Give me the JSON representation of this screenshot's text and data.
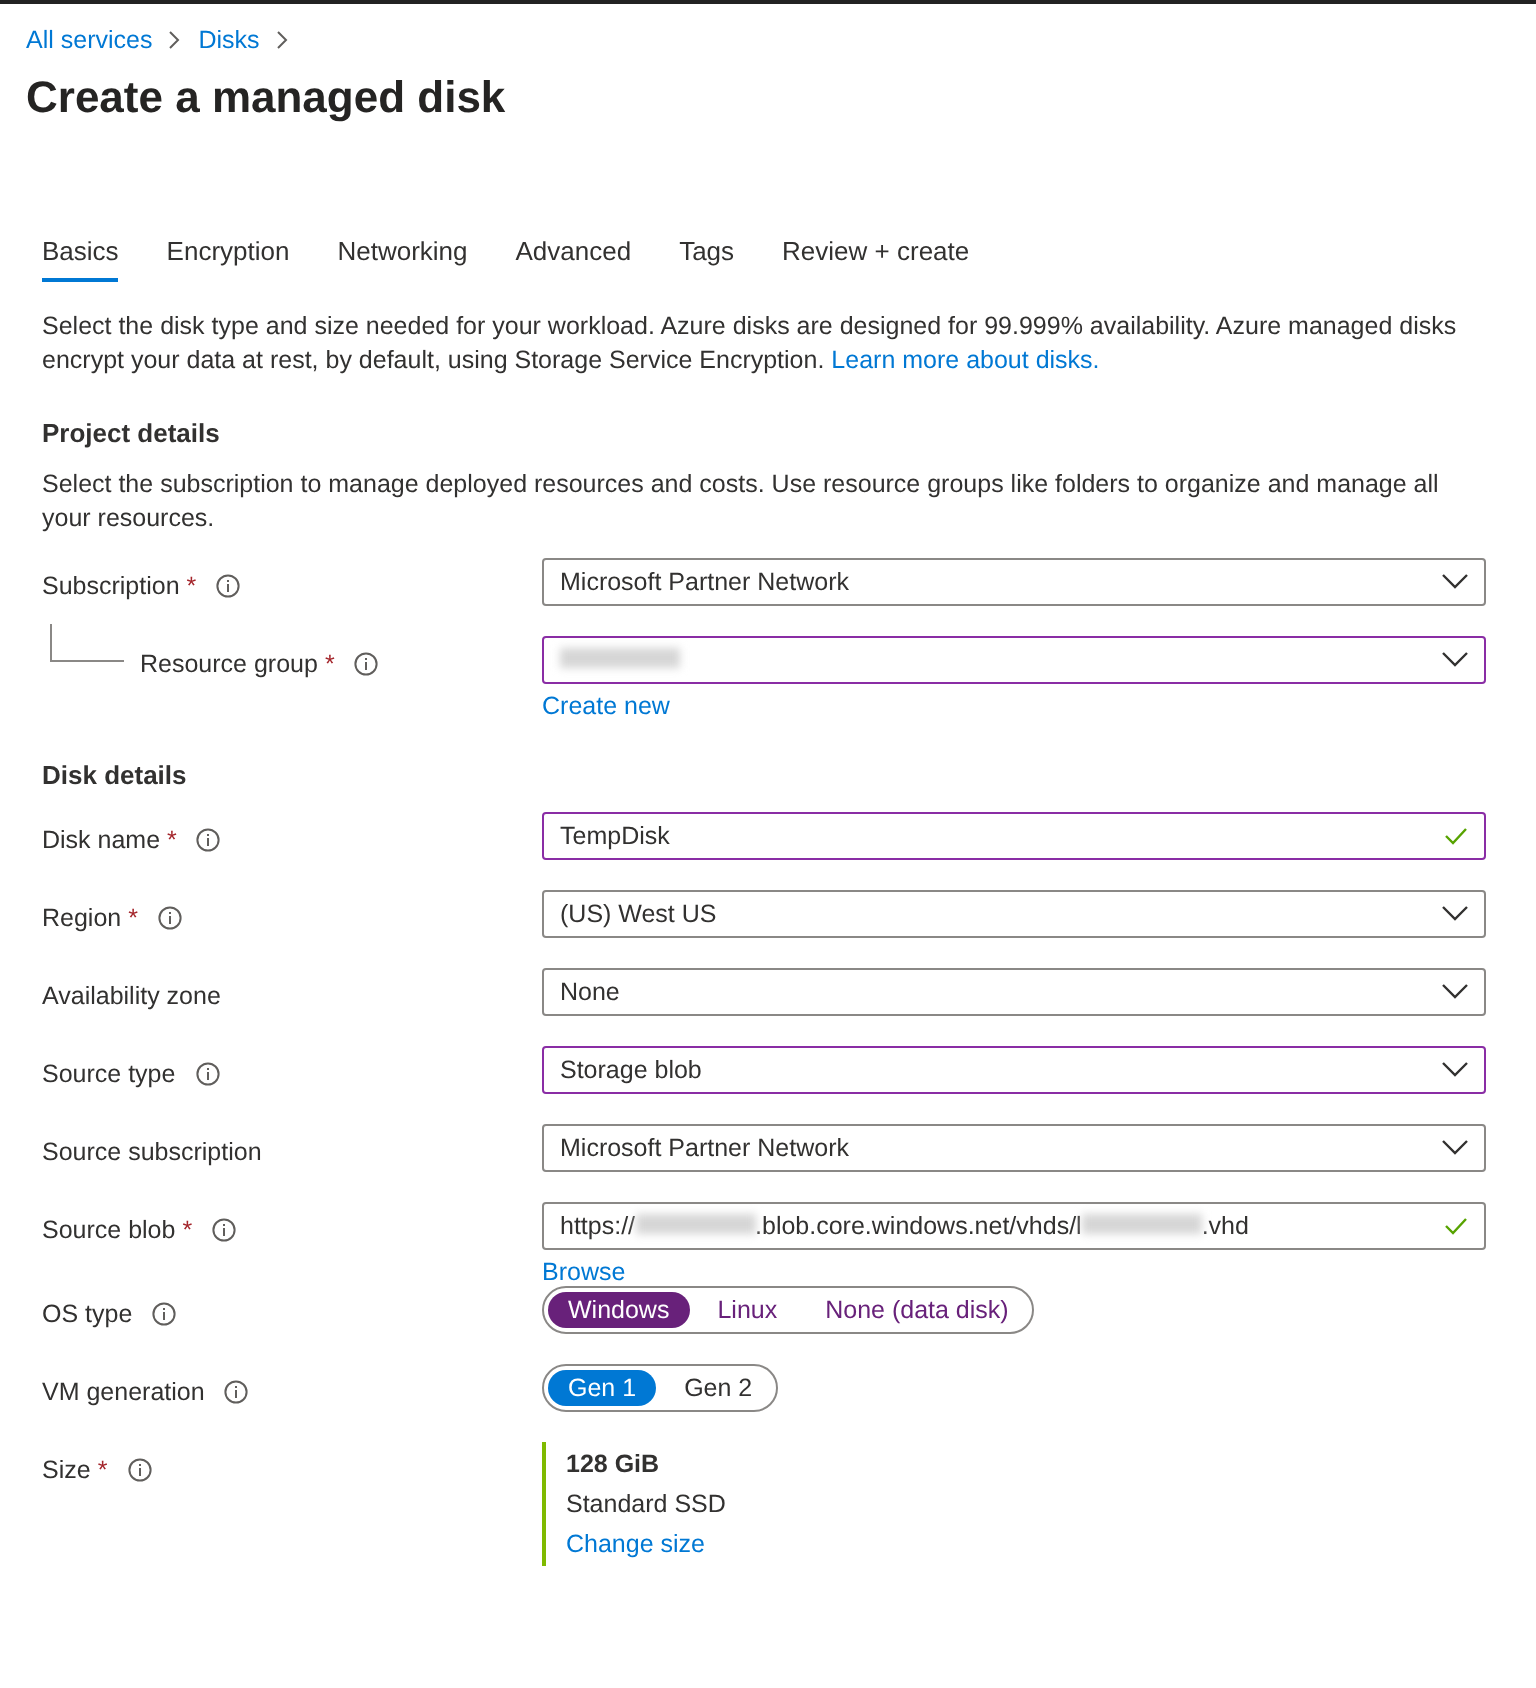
{
  "breadcrumb": [
    "All services",
    "Disks"
  ],
  "title": "Create a managed disk",
  "tabs": [
    {
      "label": "Basics",
      "selected": true
    },
    {
      "label": "Encryption",
      "selected": false
    },
    {
      "label": "Networking",
      "selected": false
    },
    {
      "label": "Advanced",
      "selected": false
    },
    {
      "label": "Tags",
      "selected": false
    },
    {
      "label": "Review + create",
      "selected": false
    }
  ],
  "intro": {
    "text": "Select the disk type and size needed for your workload. Azure disks are designed for 99.999% availability. Azure managed disks encrypt your data at rest, by default, using Storage Service Encryption.",
    "link": "Learn more about disks."
  },
  "sections": [
    {
      "heading": "Project details",
      "description": "Select the subscription to manage deployed resources and costs. Use resource groups like folders to organize and manage all your resources.",
      "rows": [
        {
          "kind": "select",
          "label": "Subscription",
          "required_mark": "*",
          "info": true,
          "highlighted": false,
          "valid": false,
          "value_parts": [
            {
              "kind": "text",
              "text": "Microsoft Partner Network"
            }
          ],
          "children": [
            {
              "kind": "select",
              "label": "Resource group",
              "required_mark": "*",
              "info": true,
              "highlighted": true,
              "valid": false,
              "value_parts": [
                {
                  "kind": "redacted"
                }
              ],
              "link": "Create new"
            }
          ]
        }
      ]
    },
    {
      "heading": "Disk details",
      "rows": [
        {
          "kind": "text",
          "label": "Disk name",
          "required_mark": "*",
          "info": true,
          "highlighted": true,
          "valid": true,
          "value_parts": [
            {
              "kind": "text",
              "text": "TempDisk"
            }
          ]
        },
        {
          "kind": "select",
          "label": "Region",
          "required_mark": "*",
          "info": true,
          "highlighted": false,
          "valid": false,
          "value_parts": [
            {
              "kind": "text",
              "text": "(US) West US"
            }
          ]
        },
        {
          "kind": "select",
          "label": "Availability zone",
          "info": false,
          "highlighted": false,
          "valid": false,
          "value_parts": [
            {
              "kind": "text",
              "text": "None"
            }
          ]
        },
        {
          "kind": "select",
          "label": "Source type",
          "info": true,
          "highlighted": true,
          "valid": false,
          "value_parts": [
            {
              "kind": "text",
              "text": "Storage blob"
            }
          ]
        },
        {
          "kind": "select",
          "label": "Source subscription",
          "info": false,
          "highlighted": false,
          "valid": false,
          "value_parts": [
            {
              "kind": "text",
              "text": "Microsoft Partner Network"
            }
          ]
        },
        {
          "kind": "text",
          "label": "Source blob",
          "required_mark": "*",
          "info": true,
          "highlighted": false,
          "valid": true,
          "value_parts": [
            {
              "kind": "text",
              "text": "https://"
            },
            {
              "kind": "redacted"
            },
            {
              "kind": "text",
              "text": ".blob.core.windows.net/vhds/l"
            },
            {
              "kind": "redacted"
            },
            {
              "kind": "text",
              "text": ".vhd"
            }
          ],
          "link": "Browse"
        },
        {
          "kind": "toggle",
          "label": "OS type",
          "info": true,
          "color": "#68217a",
          "options": [
            {
              "label": "Windows",
              "selected": true
            },
            {
              "label": "Linux",
              "selected": false
            },
            {
              "label": "None (data disk)",
              "selected": false
            }
          ]
        },
        {
          "kind": "toggle",
          "label": "VM generation",
          "info": true,
          "color": "#0078d4",
          "options": [
            {
              "label": "Gen 1",
              "selected": true
            },
            {
              "label": "Gen 2",
              "selected": false
            }
          ]
        },
        {
          "kind": "size",
          "label": "Size",
          "required_mark": "*",
          "info": true,
          "size": "128 GiB",
          "tier": "Standard SSD",
          "link": "Change size"
        }
      ]
    }
  ]
}
